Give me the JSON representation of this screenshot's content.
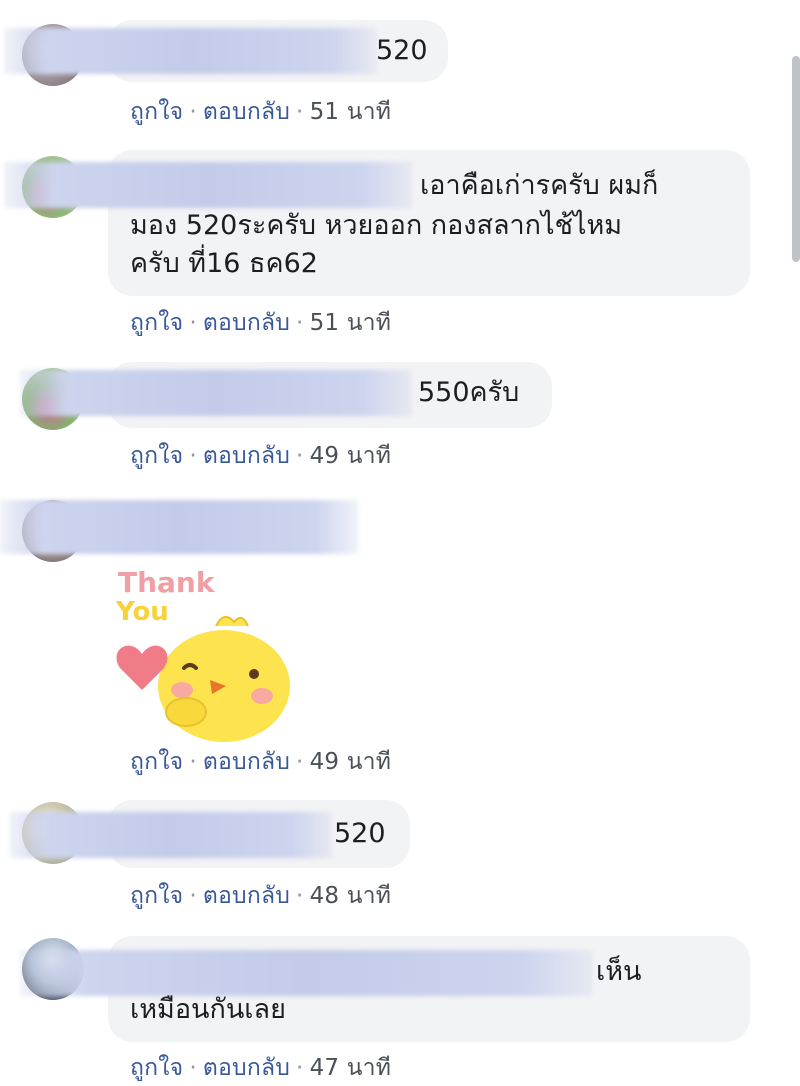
{
  "comments": [
    {
      "text": "520",
      "like_label": "ถูกใจ",
      "reply_label": "ตอบกลับ",
      "time": "51 นาที"
    },
    {
      "text_lines": [
        "เอาคือเก่ารครับ ผมก็",
        "มอง 520ระครับ หวยออก กองสลากไช้ไหม",
        "ครับ ที่16 ธค62"
      ],
      "like_label": "ถูกใจ",
      "reply_label": "ตอบกลับ",
      "time": "51 นาที"
    },
    {
      "text": "550ครับ",
      "like_label": "ถูกใจ",
      "reply_label": "ตอบกลับ",
      "time": "49 นาที"
    },
    {
      "sticker": {
        "line1": "Thank",
        "line2": "You"
      },
      "like_label": "ถูกใจ",
      "reply_label": "ตอบกลับ",
      "time": "49 นาที"
    },
    {
      "text": "520",
      "like_label": "ถูกใจ",
      "reply_label": "ตอบกลับ",
      "time": "48 นาที"
    },
    {
      "text_lines": [
        "เห็น",
        "เหมือนกันเลย"
      ],
      "like_label": "ถูกใจ",
      "reply_label": "ตอบกลับ",
      "time": "47 นาที"
    }
  ],
  "colors": {
    "bubble": "#f2f3f5",
    "action_link": "#385898",
    "timestamp": "#4b4f56",
    "name_blur": "#cdd4ee"
  }
}
